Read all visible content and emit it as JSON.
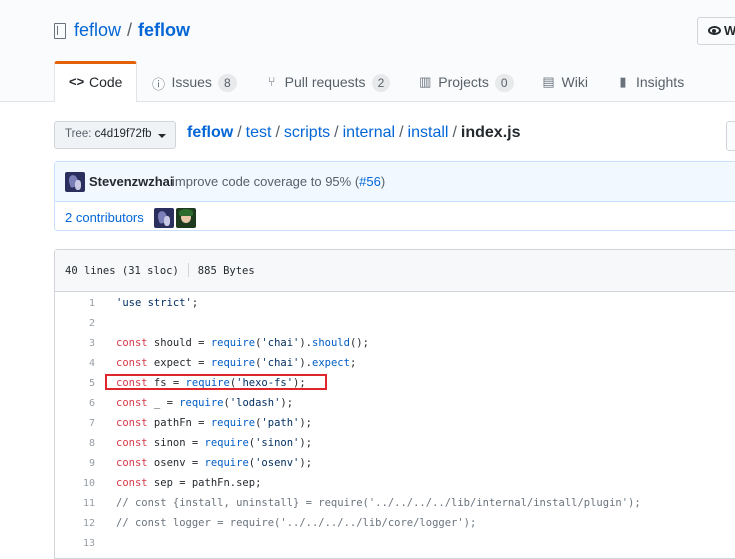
{
  "repo": {
    "owner": "feflow",
    "separator": "/",
    "name": "feflow"
  },
  "watch": {
    "label": "W"
  },
  "tabs": [
    {
      "icon": "code-icon",
      "label": "Code"
    },
    {
      "icon": "issue-icon",
      "label": "Issues",
      "count": "8"
    },
    {
      "icon": "pull-request-icon",
      "label": "Pull requests",
      "count": "2"
    },
    {
      "icon": "project-icon",
      "label": "Projects",
      "count": "0"
    },
    {
      "icon": "wiki-icon",
      "label": "Wiki"
    },
    {
      "icon": "graph-icon",
      "label": "Insights"
    }
  ],
  "branch": {
    "prefix": "Tree:",
    "value": "c4d19f72fb"
  },
  "breadcrumb": {
    "root": "feflow",
    "parts": [
      "test",
      "scripts",
      "internal",
      "install"
    ],
    "file": "index.js"
  },
  "commit": {
    "author": "Stevenzwzhai",
    "message": "improve code coverage to 95% (",
    "pr": "#56",
    "close": ")"
  },
  "contributors": {
    "label": "2 contributors"
  },
  "file": {
    "lines": "40 lines (31 sloc)",
    "size": "885 Bytes"
  },
  "code": [
    {
      "n": "1",
      "t": "'use strict';"
    },
    {
      "n": "2",
      "t": ""
    },
    {
      "n": "3",
      "t": "const should = require('chai').should();"
    },
    {
      "n": "4",
      "t": "const expect = require('chai').expect;"
    },
    {
      "n": "5",
      "t": "const fs = require('hexo-fs');"
    },
    {
      "n": "6",
      "t": "const _ = require('lodash');"
    },
    {
      "n": "7",
      "t": "const pathFn = require('path');"
    },
    {
      "n": "8",
      "t": "const sinon = require('sinon');"
    },
    {
      "n": "9",
      "t": "const osenv = require('osenv');"
    },
    {
      "n": "10",
      "t": "const sep = pathFn.sep;"
    },
    {
      "n": "11",
      "t": "// const {install, uninstall} = require('../../../../lib/internal/install/plugin');"
    },
    {
      "n": "12",
      "t": "// const logger = require('../../../../lib/core/logger');"
    },
    {
      "n": "13",
      "t": ""
    }
  ],
  "colors": {
    "link": "#0366d6",
    "tab_accent": "#e36209",
    "highlight_box": "#e0262d",
    "keyword": "#d73a49",
    "string": "#032f62"
  }
}
